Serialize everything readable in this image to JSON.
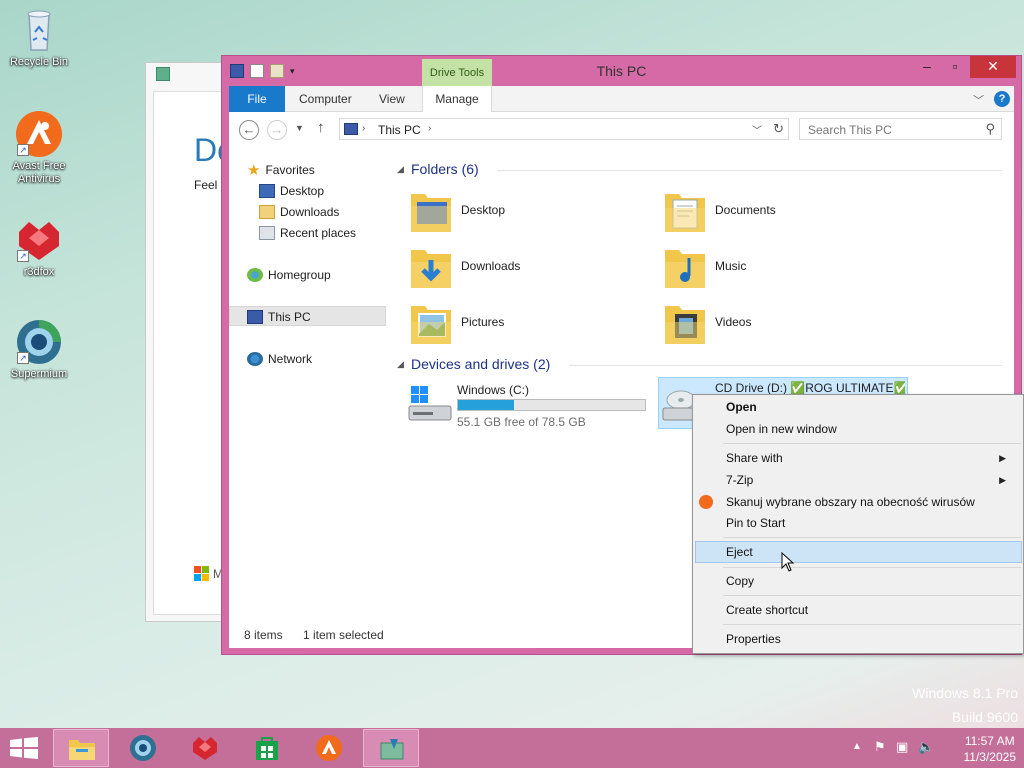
{
  "desktop": {
    "icons": [
      {
        "label": "Recycle Bin"
      },
      {
        "label": "Avast Free Antivirus"
      },
      {
        "label": "r3dfox"
      },
      {
        "label": "Supermium"
      }
    ],
    "watermark_line1": "Windows 8.1 Pro",
    "watermark_line2": "Build 9600"
  },
  "bg_window": {
    "title_fragment": "Do",
    "sub_fragment": "Feel f",
    "footer_fragment": "M"
  },
  "explorer": {
    "title": "This PC",
    "contextual_tab": "Drive Tools",
    "ribbon_tabs": [
      "File",
      "Computer",
      "View",
      "Manage"
    ],
    "address": "This PC",
    "search_placeholder": "Search This PC",
    "nav": {
      "favorites": "Favorites",
      "desktop": "Desktop",
      "downloads": "Downloads",
      "recent": "Recent places",
      "homegroup": "Homegroup",
      "thispc": "This PC",
      "network": "Network"
    },
    "folders_header": "Folders (6)",
    "folders": [
      {
        "name": "Desktop"
      },
      {
        "name": "Documents"
      },
      {
        "name": "Downloads"
      },
      {
        "name": "Music"
      },
      {
        "name": "Pictures"
      },
      {
        "name": "Videos"
      }
    ],
    "drives_header": "Devices and drives (2)",
    "drives": [
      {
        "name": "Windows (C:)",
        "free": "55.1 GB free of 78.5 GB",
        "used_fraction": 0.298
      },
      {
        "name": "CD Drive (D:) ✅ROG ULTIMATE✅"
      }
    ],
    "status_items": "8 items",
    "status_selected": "1 item selected"
  },
  "context_menu": {
    "open": "Open",
    "open_new": "Open in new window",
    "share": "Share with",
    "zip": "7-Zip",
    "scan": "Skanuj wybrane obszary na obecność wirusów",
    "pin": "Pin to Start",
    "eject": "Eject",
    "copy": "Copy",
    "shortcut": "Create shortcut",
    "properties": "Properties"
  },
  "taskbar": {
    "time": "11:57 AM",
    "date": "11/3/2025"
  },
  "colors": {
    "accent": "#d56aa6",
    "taskbar": "#c46f99",
    "file_tab": "#1979ca",
    "drive_tools": "#c4e2a6",
    "progress": "#26a0da"
  }
}
